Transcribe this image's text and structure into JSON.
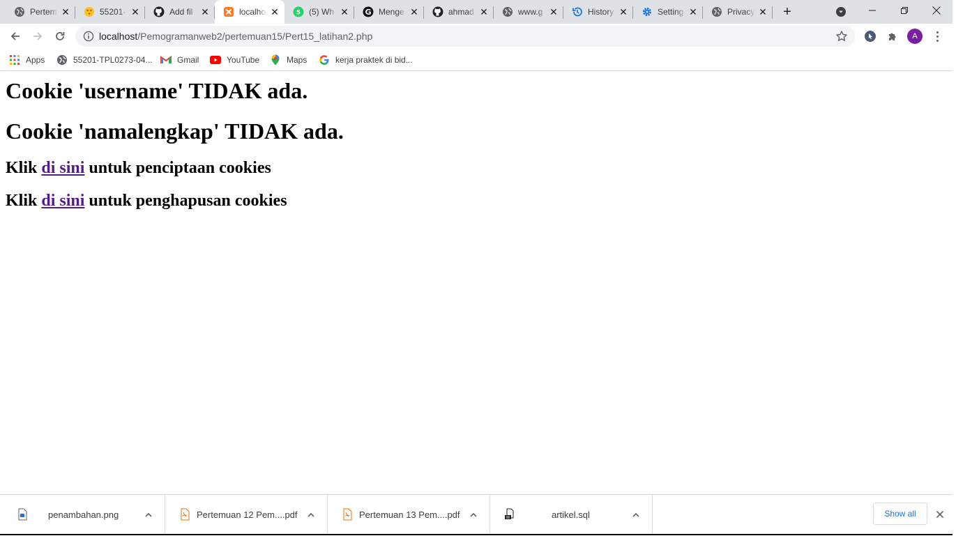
{
  "tabs": [
    {
      "title": "Pertem",
      "icon": "globe-icon"
    },
    {
      "title": "55201-",
      "icon": "moodle-icon"
    },
    {
      "title": "Add fil",
      "icon": "github-icon"
    },
    {
      "title": "localho",
      "icon": "xampp-icon",
      "active": true
    },
    {
      "title": "(5) Wh",
      "icon": "whatsapp-icon"
    },
    {
      "title": "Menge",
      "icon": "g-letter-icon"
    },
    {
      "title": "ahmad",
      "icon": "github-icon"
    },
    {
      "title": "www.g",
      "icon": "globe-icon"
    },
    {
      "title": "History",
      "icon": "history-icon"
    },
    {
      "title": "Setting",
      "icon": "gear-icon"
    },
    {
      "title": "Privacy",
      "icon": "globe-icon"
    }
  ],
  "omnibox": {
    "host": "localhost",
    "path": "/Pemogramanweb2/pertemuan15/Pert15_latihan2.php"
  },
  "profile": {
    "initial": "A",
    "color": "#7b1fa2"
  },
  "bookmarks": [
    {
      "label": "Apps",
      "icon": "apps-grid-icon"
    },
    {
      "label": "55201-TPL0273-04...",
      "icon": "globe-icon"
    },
    {
      "label": "Gmail",
      "icon": "gmail-icon"
    },
    {
      "label": "YouTube",
      "icon": "youtube-icon"
    },
    {
      "label": "Maps",
      "icon": "maps-pin-icon"
    },
    {
      "label": "kerja praktek di bid...",
      "icon": "google-icon"
    }
  ],
  "page": {
    "heading1": "Cookie 'username' TIDAK ada.",
    "heading2": "Cookie 'namalengkap' TIDAK ada.",
    "line1": {
      "prefix": "Klik",
      "link": "di sini",
      "suffix": "untuk penciptaan cookies"
    },
    "line2": {
      "prefix": "Klik",
      "link": "di sini",
      "suffix": "untuk penghapusan cookies"
    },
    "link_color": "#551a8b"
  },
  "downloads": {
    "items": [
      {
        "name": "penambahan.png",
        "icon": "image-file-icon"
      },
      {
        "name": "Pertemuan 12 Pem....pdf",
        "icon": "pdf-file-icon"
      },
      {
        "name": "Pertemuan 13 Pem....pdf",
        "icon": "pdf-file-icon"
      },
      {
        "name": "artikel.sql",
        "icon": "sql-file-icon"
      }
    ],
    "show_all_label": "Show all"
  },
  "colors": {
    "tabstrip": "#dee1e6",
    "omnibox": "#f1f3f4",
    "accent_blue": "#1a73e8"
  }
}
